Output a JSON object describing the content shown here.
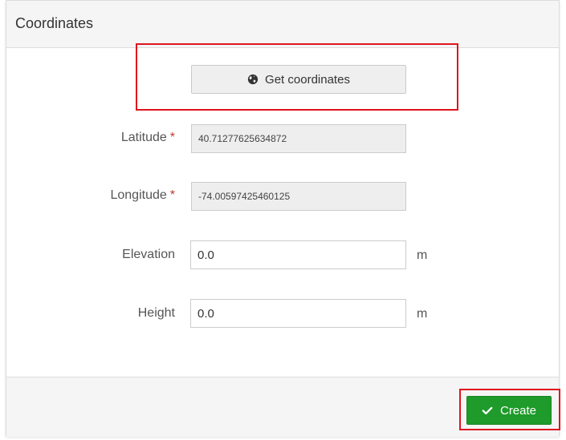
{
  "panel": {
    "title": "Coordinates"
  },
  "get_coordinates": {
    "label": "Get coordinates",
    "icon": "globe-icon"
  },
  "fields": {
    "latitude": {
      "label": "Latitude",
      "required_marker": "*",
      "value": "40.71277625634872"
    },
    "longitude": {
      "label": "Longitude",
      "required_marker": "*",
      "value": "-74.00597425460125"
    },
    "elevation": {
      "label": "Elevation",
      "value": "0.0",
      "unit": "m"
    },
    "height": {
      "label": "Height",
      "value": "0.0",
      "unit": "m"
    }
  },
  "footer": {
    "create_label": "Create",
    "create_icon": "check-icon"
  },
  "colors": {
    "highlight": "#e0141e",
    "success": "#1e9b2a",
    "required": "#c0392b"
  }
}
